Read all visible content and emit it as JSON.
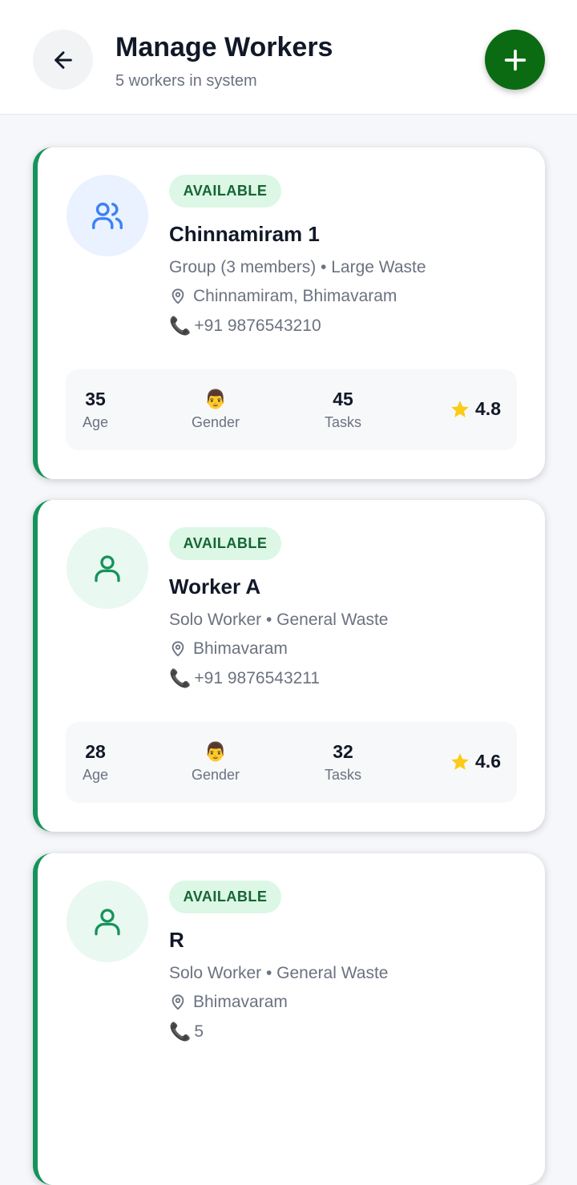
{
  "header": {
    "title": "Manage Workers",
    "subtitle": "5 workers in system"
  },
  "workers": [
    {
      "status": "AVAILABLE",
      "name": "Chinnamiram 1",
      "description": "Group (3 members) • Large Waste",
      "location": "Chinnamiram, Bhimavaram",
      "phone": "+91 9876543210",
      "avatar_icon": "group-icon",
      "age": "35",
      "age_label": "Age",
      "gender": "👨",
      "gender_label": "Gender",
      "tasks": "45",
      "tasks_label": "Tasks",
      "rating": "4.8"
    },
    {
      "status": "AVAILABLE",
      "name": "Worker A",
      "description": "Solo Worker • General Waste",
      "location": "Bhimavaram",
      "phone": "+91 9876543211",
      "avatar_icon": "user-icon",
      "age": "28",
      "age_label": "Age",
      "gender": "👨",
      "gender_label": "Gender",
      "tasks": "32",
      "tasks_label": "Tasks",
      "rating": "4.6"
    },
    {
      "status": "AVAILABLE",
      "name": "R",
      "description": "Solo Worker • General Waste",
      "location": "Bhimavaram",
      "phone": "5",
      "avatar_icon": "user-icon"
    }
  ],
  "colors": {
    "accent_green": "#0b6b12",
    "card_border": "#16935a",
    "badge_bg": "#dcf7e5",
    "badge_text": "#166534",
    "group_icon": "#3b82f6",
    "solo_icon": "#16935a",
    "star": "#facc15"
  }
}
